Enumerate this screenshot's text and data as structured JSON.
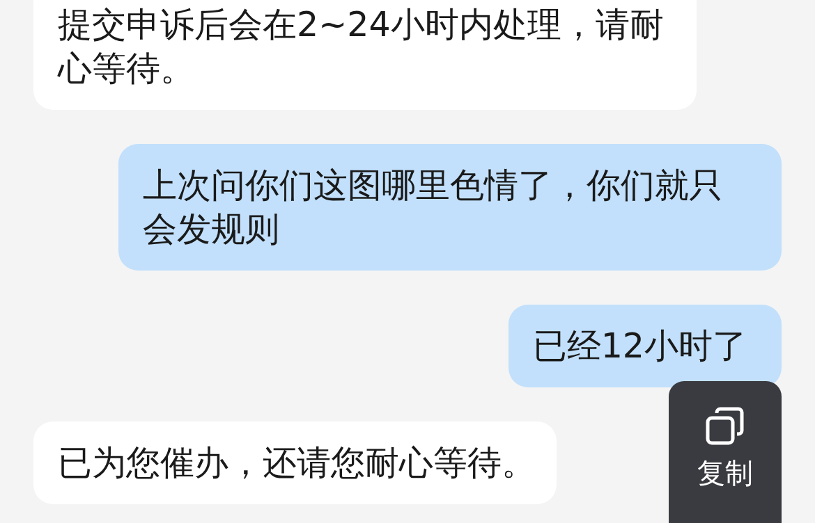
{
  "messages": [
    {
      "kind": "incoming",
      "text": "提交申诉后会在2~24小时内处理，请耐心等待。"
    },
    {
      "kind": "outgoing",
      "text": "上次问你们这图哪里色情了，你们就只会发规则"
    },
    {
      "kind": "outgoing",
      "text": "已经12小时了"
    },
    {
      "kind": "incoming",
      "text": "已为您催办，还请您耐心等待。"
    }
  ],
  "context_menu": {
    "items": [
      {
        "label": "复制"
      }
    ]
  }
}
